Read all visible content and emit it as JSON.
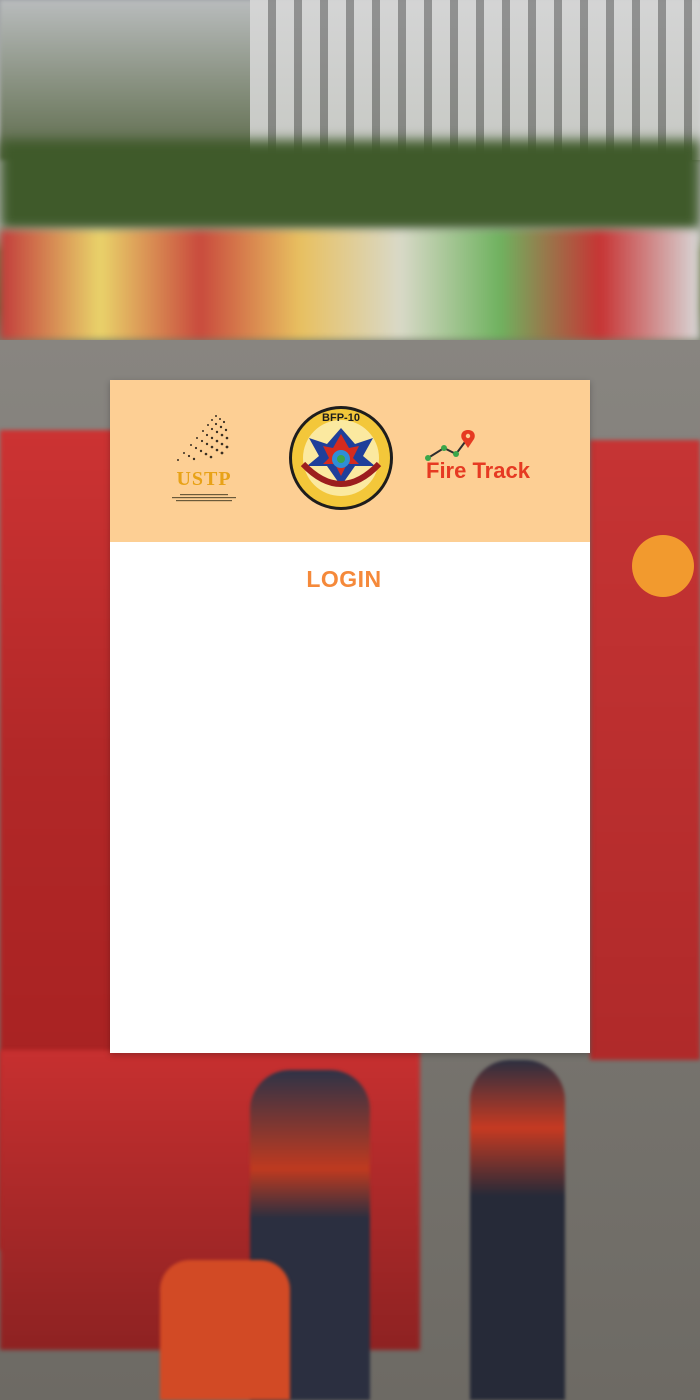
{
  "header": {
    "logos": [
      {
        "name": "ustp-logo",
        "text": "USTP"
      },
      {
        "name": "bfp-seal",
        "text": "BFP-10"
      },
      {
        "name": "firetrack-logo",
        "text": "Fire Track"
      }
    ]
  },
  "login": {
    "title": "LOGIN"
  },
  "colors": {
    "header_bg": "#fdcf94",
    "title": "#f5893a",
    "brand_red": "#e63a22",
    "ustp_gold": "#e8a217"
  }
}
